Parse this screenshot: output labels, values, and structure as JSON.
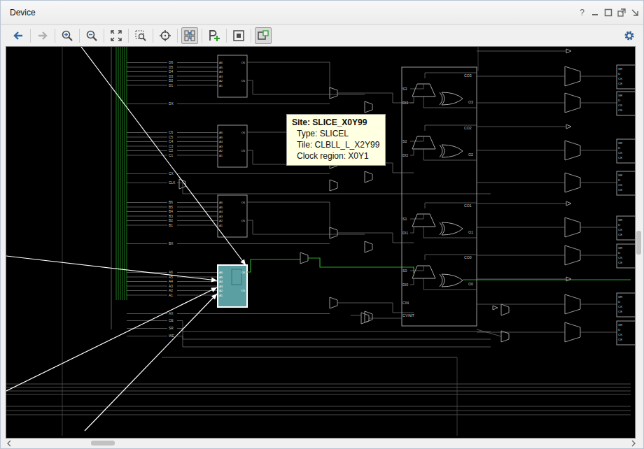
{
  "window": {
    "title": "Device",
    "help": "?"
  },
  "toolbar": [
    {
      "kind": "back",
      "disabled": false,
      "selected": false
    },
    {
      "kind": "forward",
      "disabled": true,
      "selected": false
    },
    {
      "kind": "zoom-in",
      "disabled": false,
      "selected": false
    },
    {
      "kind": "zoom-out",
      "disabled": false,
      "selected": false
    },
    {
      "kind": "zoom-fit",
      "disabled": false,
      "selected": false
    },
    {
      "kind": "zoom-area",
      "disabled": false,
      "selected": false
    },
    {
      "kind": "center",
      "disabled": false,
      "selected": false
    },
    {
      "kind": "routing",
      "disabled": false,
      "selected": true
    },
    {
      "kind": "pblock",
      "disabled": false,
      "selected": false
    },
    {
      "kind": "box",
      "disabled": false,
      "selected": false
    },
    {
      "kind": "toggle",
      "disabled": false,
      "selected": true
    },
    {
      "kind": "settings",
      "disabled": false,
      "selected": false
    }
  ],
  "pins": {
    "groups": [
      {
        "inputs": [
          "D6",
          "D5",
          "D4",
          "D3",
          "D2",
          "D1"
        ],
        "bypass": "DX"
      },
      {
        "inputs": [
          "C6",
          "C5",
          "C4",
          "C3",
          "C2",
          "C1"
        ],
        "bypass": "CX"
      },
      {
        "inputs": [
          "B6",
          "B5",
          "B4",
          "B3",
          "B2",
          "B1"
        ],
        "bypass": "BX"
      },
      {
        "inputs": [
          "A6",
          "A5",
          "A4",
          "A3",
          "A2",
          "A1"
        ],
        "bypass": "AX"
      }
    ],
    "control": [
      "CLK",
      "CE",
      "SR",
      "WE"
    ]
  },
  "luts": [
    {
      "inputs": [
        "A6",
        "A5",
        "A4",
        "A3",
        "A2",
        "A1"
      ],
      "outputs": [
        "O6",
        "O5"
      ],
      "selected": false
    },
    {
      "inputs": [
        "A6",
        "A5",
        "A4",
        "A3",
        "A2",
        "A1"
      ],
      "outputs": [
        "O6",
        "O5"
      ],
      "selected": false
    },
    {
      "inputs": [
        "A6",
        "A5",
        "A4",
        "A3",
        "A2",
        "A1"
      ],
      "outputs": [
        "O6",
        "O5"
      ],
      "selected": false
    },
    {
      "inputs": [
        "A6",
        "A5",
        "A4",
        "A3",
        "A2",
        "A1"
      ],
      "outputs": [
        "O6",
        "O5"
      ],
      "selected": true
    }
  ],
  "carry": {
    "stages": [
      {
        "co": "CO3",
        "o": "O3",
        "s": "S3",
        "di": "DI3"
      },
      {
        "co": "CO2",
        "o": "O2",
        "s": "S2",
        "di": "DI2"
      },
      {
        "co": "CO1",
        "o": "O1",
        "s": "S1",
        "di": "DI1"
      },
      {
        "co": "CO0",
        "o": "O0",
        "s": "S0",
        "di": "DI0"
      }
    ],
    "cin": "CIN",
    "cyinit": "CYINIT"
  },
  "flipflops": [
    {
      "pins": [
        "SR",
        "D",
        "CK",
        "CE"
      ]
    },
    {
      "pins": [
        "SR",
        "D",
        "CK",
        "CE"
      ]
    },
    {
      "pins": [
        "SR",
        "D",
        "CK",
        "CE"
      ]
    },
    {
      "pins": [
        "SR",
        "D",
        "CK",
        "CE"
      ]
    },
    {
      "pins": [
        "SR",
        "D",
        "CK",
        "CE"
      ]
    },
    {
      "pins": [
        "SR",
        "D",
        "CK",
        "CE"
      ]
    },
    {
      "pins": [
        "SR",
        "D",
        "CK",
        "CE"
      ]
    },
    {
      "pins": [
        "SR",
        "D",
        "CK",
        "CE"
      ]
    }
  ],
  "tooltip": {
    "title": "Site: SLICE_X0Y99",
    "lines": [
      "Type: SLICEL",
      "Tile: CLBLL_L_X2Y99",
      "Clock region: X0Y1"
    ]
  },
  "scroll": {
    "horizontal": {
      "level": 0.13
    },
    "vertical": {
      "level": 0.5
    }
  }
}
